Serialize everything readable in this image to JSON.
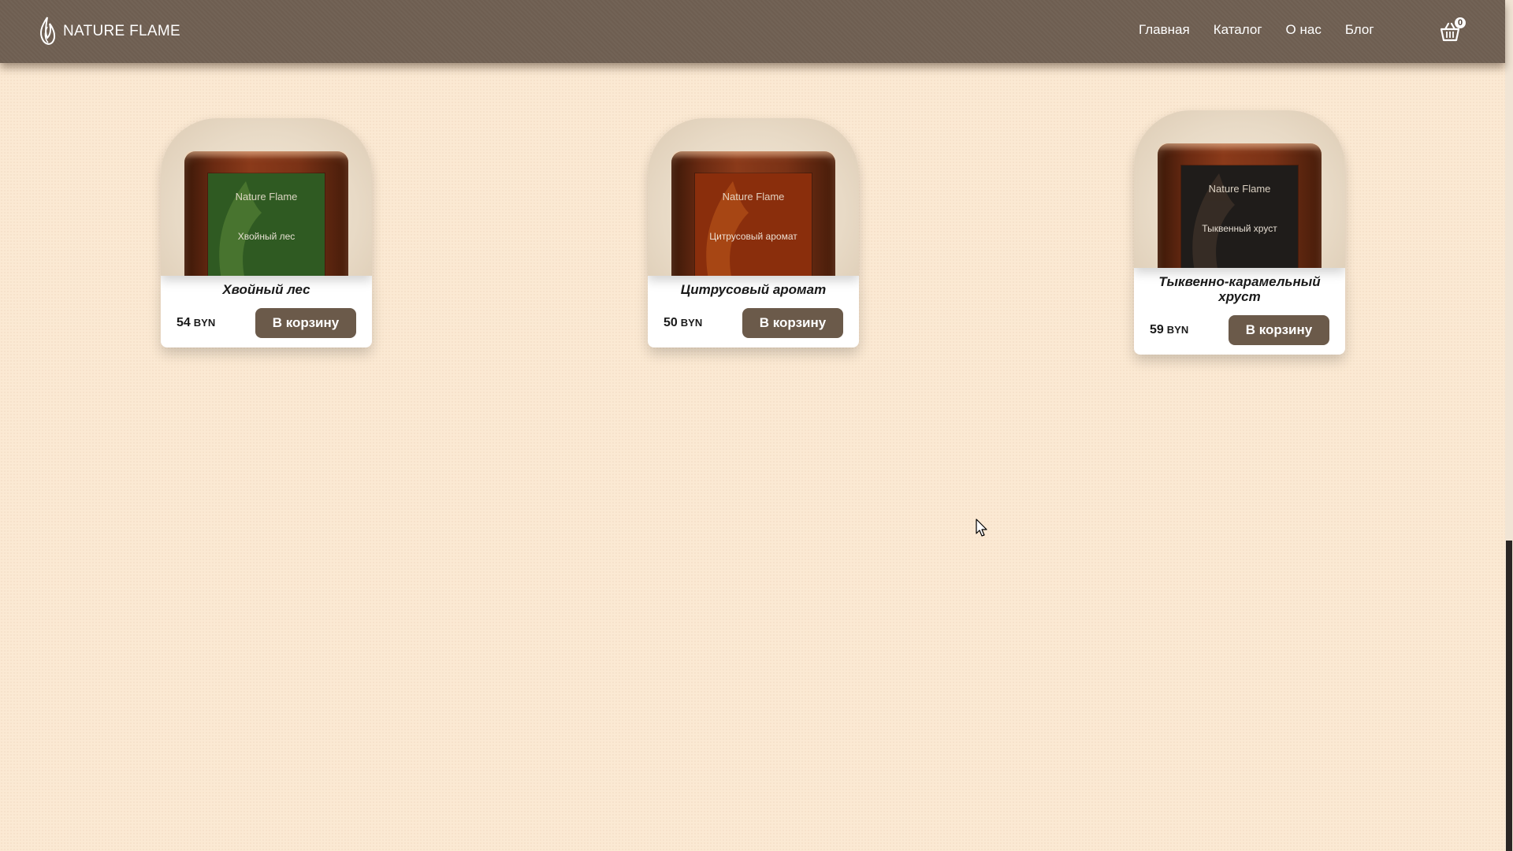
{
  "header": {
    "logo_text": "NATURE FLAME",
    "nav": [
      "Главная",
      "Каталог",
      "О нас",
      "Блог"
    ],
    "cart_count": "0"
  },
  "products": [
    {
      "title": "Хвойный лес",
      "price": "54",
      "currency": "BYN",
      "button": "В корзину",
      "label_brand": "Nature Flame",
      "label_name": "Хвойный лес",
      "label_color": "#2f5a22"
    },
    {
      "title": "Цитрусовый аромат",
      "price": "50",
      "currency": "BYN",
      "button": "В корзину",
      "label_brand": "Nature Flame",
      "label_name": "Цитрусовый аромат",
      "label_color": "#8a2e0c"
    },
    {
      "title": "Тыквенно-карамельный хруст",
      "price": "59",
      "currency": "BYN",
      "button": "В корзину",
      "label_brand": "Nature Flame",
      "label_name": "Тыквенный хруст",
      "label_color": "#1f1c1a"
    }
  ],
  "colors": {
    "page_bg": "#fbe9d3",
    "header_bg": "#6e5e51",
    "button_bg": "#6b5a4a"
  }
}
